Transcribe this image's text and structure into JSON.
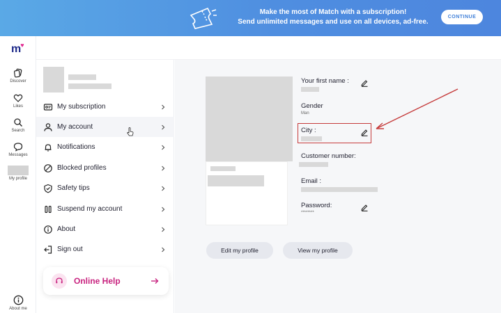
{
  "banner": {
    "line1": "Make the most of Match with a subscription!",
    "line2": "Send unlimited messages and use on all devices, ad-free.",
    "continue_label": "CONTINUE"
  },
  "rail": {
    "logo": "m",
    "items": [
      {
        "label": "Discover",
        "icon": "discover-icon"
      },
      {
        "label": "Likes",
        "icon": "heart-icon"
      },
      {
        "label": "Search",
        "icon": "search-icon"
      },
      {
        "label": "Messages",
        "icon": "chat-bubble-icon"
      },
      {
        "label": "My profile",
        "icon": "avatar"
      }
    ],
    "about_label": "About me"
  },
  "menu": {
    "items": [
      {
        "label": "My subscription",
        "icon": "subscription-icon"
      },
      {
        "label": "My account",
        "icon": "user-icon"
      },
      {
        "label": "Notifications",
        "icon": "bell-icon"
      },
      {
        "label": "Blocked profiles",
        "icon": "block-icon"
      },
      {
        "label": "Safety tips",
        "icon": "shield-icon"
      },
      {
        "label": "Suspend my account",
        "icon": "pause-icon"
      },
      {
        "label": "About",
        "icon": "info-icon"
      },
      {
        "label": "Sign out",
        "icon": "sign-out-icon"
      }
    ],
    "help_label": "Online Help"
  },
  "account": {
    "first_name_label": "Your first name :",
    "gender_label": "Gender",
    "gender_value": "Man",
    "city_label": "City :",
    "customer_number_label": "Customer number:",
    "email_label": "Email :",
    "password_label": "Password:",
    "password_value": "********",
    "edit_profile_label": "Edit my profile",
    "view_profile_label": "View my profile"
  },
  "colors": {
    "accent_pink": "#c8237f",
    "brand_blue": "#1e2a8a",
    "annotation_red": "#c53a3a"
  }
}
